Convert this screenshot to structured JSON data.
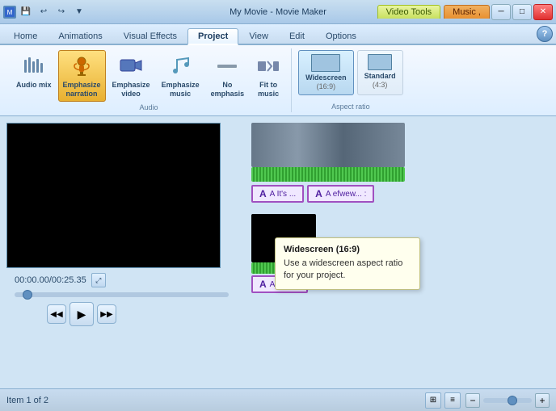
{
  "window": {
    "title": "My Movie - Movie Maker",
    "video_tools_label": "Video Tools",
    "music_label": "Music ,"
  },
  "ribbon_tabs": [
    {
      "label": "Home",
      "active": false
    },
    {
      "label": "Animations",
      "active": false
    },
    {
      "label": "Visual Effects",
      "active": false
    },
    {
      "label": "Project",
      "active": true
    },
    {
      "label": "View",
      "active": false
    },
    {
      "label": "Edit",
      "active": false
    },
    {
      "label": "Options",
      "active": false
    }
  ],
  "audio_group": {
    "label": "Audio",
    "buttons": [
      {
        "id": "audio-mix",
        "label": "Audio mix",
        "sub": ""
      },
      {
        "id": "emph-narration",
        "label": "Emphasize narration",
        "sub": ""
      },
      {
        "id": "emph-video",
        "label": "Emphasize video",
        "sub": ""
      },
      {
        "id": "emph-music",
        "label": "Emphasize music",
        "sub": ""
      },
      {
        "id": "no-emphasis",
        "label": "No emphasis",
        "sub": ""
      },
      {
        "id": "fit-to-music",
        "label": "Fit to music",
        "sub": ""
      }
    ]
  },
  "aspect_group": {
    "label": "Aspect ratio",
    "widescreen": {
      "label": "Widescreen",
      "sub": "(16:9)"
    },
    "standard": {
      "label": "Standard",
      "sub": "(4:3)"
    }
  },
  "tooltip": {
    "title": "Widescreen (16:9)",
    "text": "Use a widescreen aspect ratio for your project."
  },
  "preview": {
    "time": "00:00.00/00:25.35"
  },
  "timeline": {
    "clips": [
      {
        "title_card1": "A It's ...",
        "title_card2": "A efwew... :"
      },
      {
        "title_card3": "A Happy"
      }
    ]
  },
  "status": {
    "text": "Item 1 of 2"
  },
  "qat_buttons": [
    "save",
    "undo",
    "redo",
    "dropdown"
  ]
}
